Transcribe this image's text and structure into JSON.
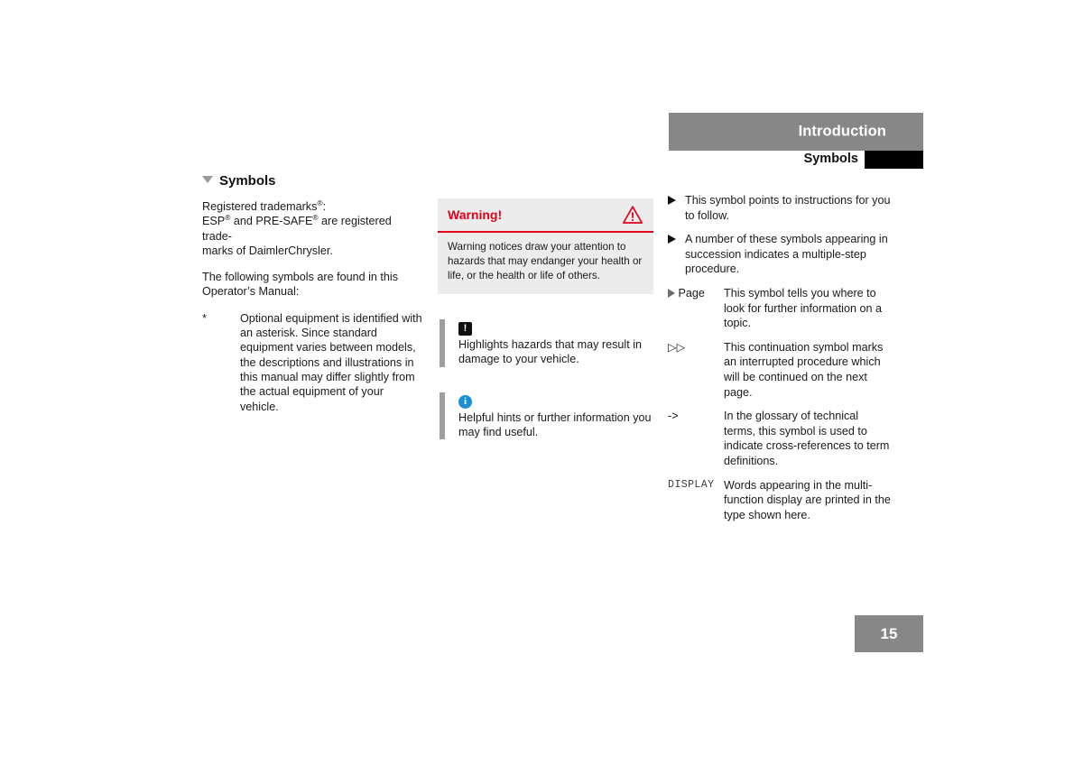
{
  "header": {
    "chapter_title": "Introduction",
    "section_title": "Symbols",
    "tab_marker_color": "#000000",
    "bar_color": "#878787"
  },
  "page_number": "15",
  "left_column": {
    "heading": "Symbols",
    "heading_marker_icon": "triangle-down-icon",
    "paragraphs": [
      {
        "id": "trademarks",
        "line1_pre": "Registered trademarks",
        "line1_sup": "®",
        "line1_post": ":",
        "line2_a": "ESP",
        "line2_sup_a": "®",
        "line2_b": " and PRE-SAFE",
        "line2_sup_b": "®",
        "line2_c": " are registered trade-",
        "line3": "marks of DaimlerChrysler."
      },
      {
        "id": "intro",
        "text": "The following symbols are found in this Operator’s Manual:"
      }
    ],
    "asterisk_note": {
      "marker": "*",
      "text": "Optional equipment is identified with an asterisk. Since standard equipment varies between models, the descriptions and illustrations in this manual may differ slightly from the actual equipment of your vehicle."
    }
  },
  "middle_column": {
    "warning_box": {
      "label": "Warning!",
      "icon": "warning-triangle-icon",
      "accent_color": "#e2001a",
      "background_color": "#ececec",
      "text": "Warning notices draw your attention to hazards that may endanger your health or life, or the health or life of others."
    },
    "hints": [
      {
        "id": "damage-hint",
        "icon": "exclamation-square-icon",
        "icon_glyph": "!",
        "icon_color": "#111111",
        "text": "Highlights hazards that may result in damage to your vehicle."
      },
      {
        "id": "info-hint",
        "icon": "info-circle-icon",
        "icon_glyph": "i",
        "icon_color": "#1b8fd4",
        "text": "Helpful hints or further information you may find useful."
      }
    ]
  },
  "right_column": {
    "legend": [
      {
        "id": "instruction-arrow",
        "symbol_kind": "triangle-right-filled-icon",
        "symbol_text": "",
        "description": "This symbol points to instructions for you to follow."
      },
      {
        "id": "multi-step-arrow",
        "symbol_kind": "triangle-right-filled-icon",
        "symbol_text": "",
        "description": "A number of these symbols appearing in succession indicates a multiple-step procedure."
      },
      {
        "id": "page-reference",
        "symbol_kind": "triangle-right-open-icon",
        "symbol_text": "Page",
        "description": "This symbol tells you where to look for further information on a topic."
      },
      {
        "id": "continuation",
        "symbol_kind": "double-triangle-right-open-icon",
        "symbol_text": "▷▷",
        "description": "This continuation symbol marks an interrupted procedure which will be continued on the next page."
      },
      {
        "id": "glossary-cross-reference",
        "symbol_kind": "arrow-text-icon",
        "symbol_text": "->",
        "description": "In the glossary of technical terms, this symbol is used to indicate cross-references to term definitions."
      },
      {
        "id": "display-type",
        "symbol_kind": "monospace-label",
        "symbol_text": "DISPLAY",
        "description": "Words appearing in the multi-function display are printed in the type shown here."
      }
    ]
  }
}
